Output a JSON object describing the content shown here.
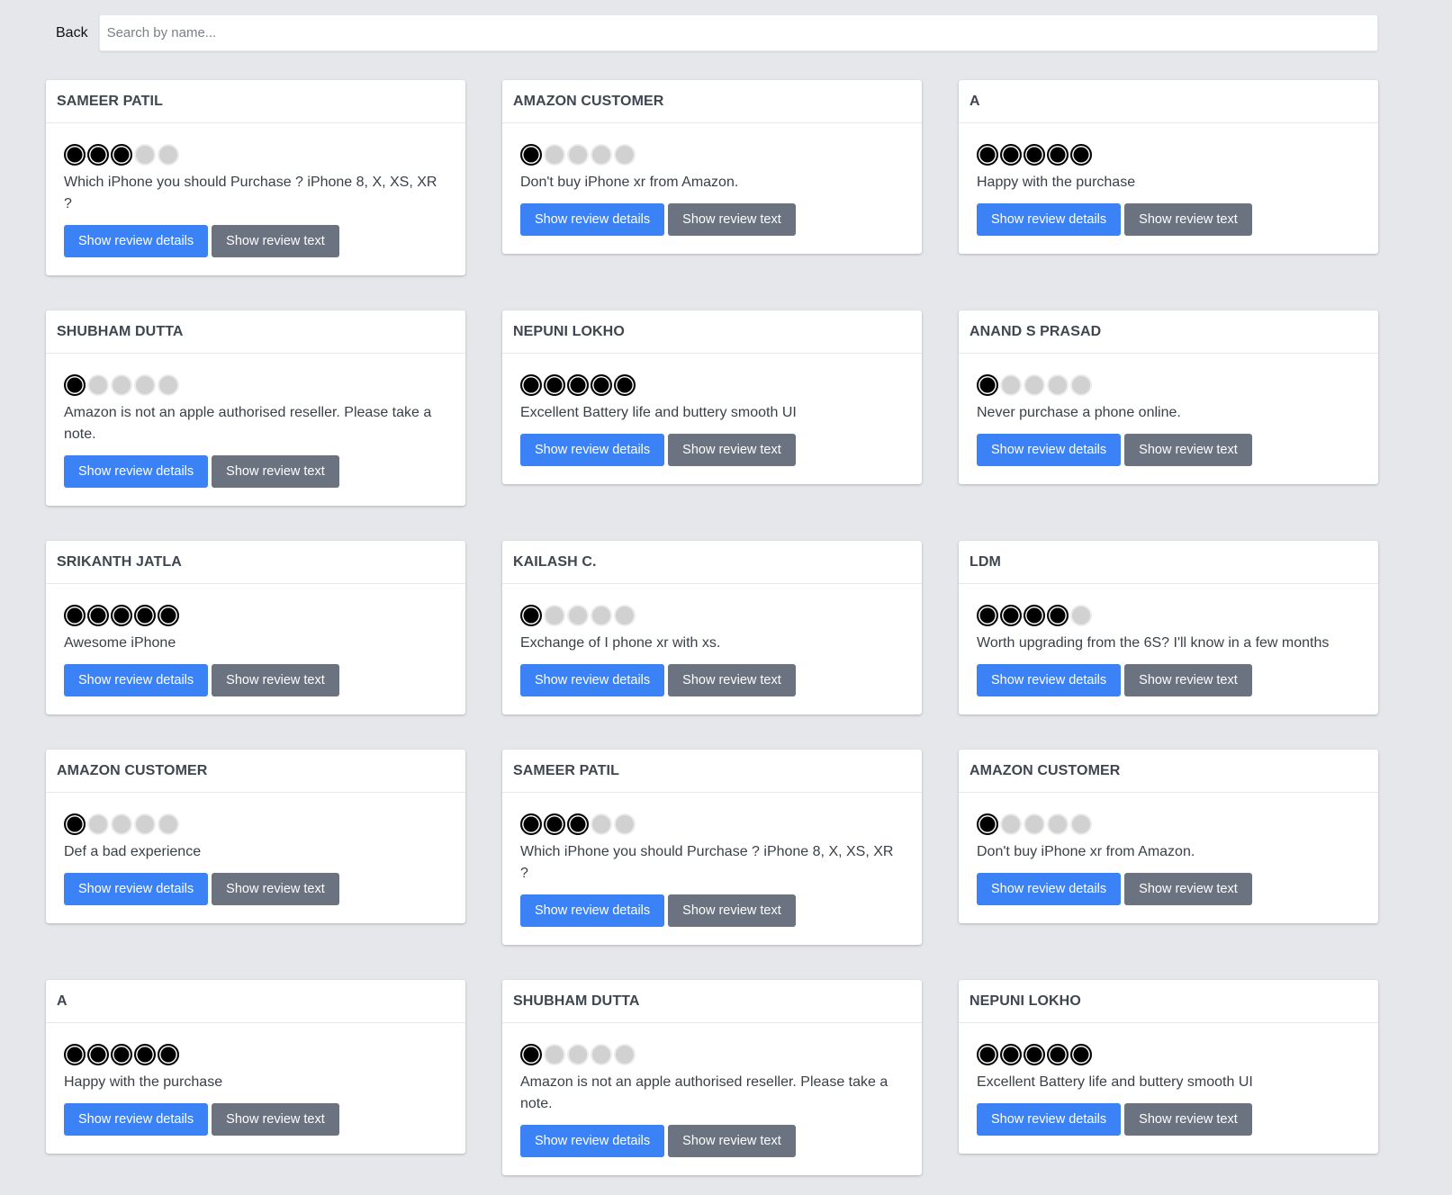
{
  "toolbar": {
    "back_label": "Back",
    "search_placeholder": "Search by name..."
  },
  "buttons": {
    "details_label": "Show review details",
    "text_label": "Show review text"
  },
  "rating_max": 5,
  "colors": {
    "page_bg": "#e5e7eb",
    "primary_button": "#3b82f6",
    "secondary_button": "#6b7280",
    "star_filled": "#000000",
    "star_empty": "#d1d1d1"
  },
  "reviews": [
    {
      "name": "Sameer Patil",
      "rating": 3,
      "title": "Which iPhone you should Purchase ? iPhone 8, X, XS, XR ?"
    },
    {
      "name": "Amazon Customer",
      "rating": 1,
      "title": "Don't buy iPhone xr from Amazon."
    },
    {
      "name": "A",
      "rating": 5,
      "title": "Happy with the purchase"
    },
    {
      "name": "Shubham Dutta",
      "rating": 1,
      "title": "Amazon is not an apple authorised reseller. Please take a note."
    },
    {
      "name": "Nepuni Lokho",
      "rating": 5,
      "title": "Excellent Battery life and buttery smooth UI"
    },
    {
      "name": "Anand S Prasad",
      "rating": 1,
      "title": "Never purchase a phone online."
    },
    {
      "name": "Srikanth Jatla",
      "rating": 5,
      "title": "Awesome iPhone"
    },
    {
      "name": "Kailash C.",
      "rating": 1,
      "title": "Exchange of I phone xr with xs."
    },
    {
      "name": "LDM",
      "rating": 4,
      "title": "Worth upgrading from the 6S? I'll know in a few months"
    },
    {
      "name": "Amazon Customer",
      "rating": 1,
      "title": "Def a bad experience"
    },
    {
      "name": "Sameer Patil",
      "rating": 3,
      "title": "Which iPhone you should Purchase ? iPhone 8, X, XS, XR ?"
    },
    {
      "name": "Amazon Customer",
      "rating": 1,
      "title": "Don't buy iPhone xr from Amazon."
    },
    {
      "name": "A",
      "rating": 5,
      "title": "Happy with the purchase"
    },
    {
      "name": "Shubham Dutta",
      "rating": 1,
      "title": "Amazon is not an apple authorised reseller. Please take a note."
    },
    {
      "name": "Nepuni Lokho",
      "rating": 5,
      "title": "Excellent Battery life and buttery smooth UI"
    }
  ]
}
